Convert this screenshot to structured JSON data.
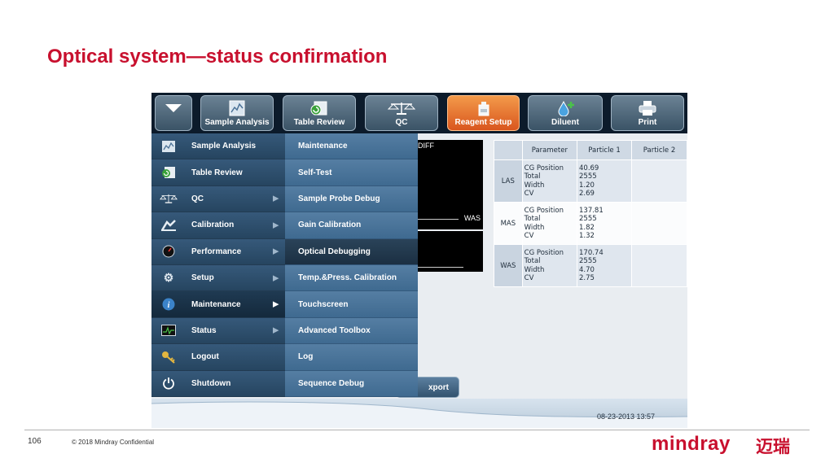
{
  "slide": {
    "title": "Optical system—status confirmation",
    "page_number": "106",
    "copyright": "© 2018 Mindray Confidential",
    "logo_text": "mindray",
    "logo_cn": "迈瑞",
    "brand_color": "#c8102e"
  },
  "toolbar": {
    "menu_icon": "triangle-down-icon",
    "buttons": [
      {
        "label": "Sample Analysis",
        "icon": "sample-analysis-icon"
      },
      {
        "label": "Table Review",
        "icon": "table-review-icon"
      },
      {
        "label": "QC",
        "icon": "scale-icon"
      },
      {
        "label": "Reagent Setup",
        "icon": "reagent-icon",
        "active": true
      },
      {
        "label": "Diluent",
        "icon": "diluent-icon"
      },
      {
        "label": "Print",
        "icon": "printer-icon"
      }
    ]
  },
  "main_menu": {
    "items": [
      {
        "label": "Sample Analysis",
        "icon": "sample-analysis-icon",
        "submenu": false
      },
      {
        "label": "Table Review",
        "icon": "table-review-icon",
        "submenu": false
      },
      {
        "label": "QC",
        "icon": "scale-icon",
        "submenu": true
      },
      {
        "label": "Calibration",
        "icon": "calibration-icon",
        "submenu": true
      },
      {
        "label": "Performance",
        "icon": "performance-icon",
        "submenu": true
      },
      {
        "label": "Setup",
        "icon": "gear-icon",
        "submenu": true
      },
      {
        "label": "Maintenance",
        "icon": "info-icon",
        "submenu": true,
        "selected": true
      },
      {
        "label": "Status",
        "icon": "status-icon",
        "submenu": true
      },
      {
        "label": "Logout",
        "icon": "key-icon",
        "submenu": false
      },
      {
        "label": "Shutdown",
        "icon": "power-icon",
        "submenu": false
      }
    ]
  },
  "submenu": {
    "items": [
      {
        "label": "Maintenance"
      },
      {
        "label": "Self-Test"
      },
      {
        "label": "Sample Probe Debug"
      },
      {
        "label": "Gain Calibration"
      },
      {
        "label": "Optical Debugging",
        "selected": true
      },
      {
        "label": "Temp.&Press. Calibration"
      },
      {
        "label": "Touchscreen"
      },
      {
        "label": "Advanced Toolbox"
      },
      {
        "label": "Log"
      },
      {
        "label": "Sequence Debug"
      }
    ]
  },
  "plots": {
    "diff_label": "DIFF",
    "was_label": "WAS"
  },
  "export_button": {
    "label": "xport"
  },
  "params_table": {
    "headers": [
      "Parameter",
      "Particle 1",
      "Particle 2"
    ],
    "rows": [
      {
        "label": "LAS",
        "params": [
          "CG Position",
          "Total",
          "Width",
          "CV"
        ],
        "p1": [
          "40.69",
          "2555",
          "1.20",
          "2.69"
        ],
        "p2": [
          "",
          "",
          "",
          ""
        ]
      },
      {
        "label": "MAS",
        "params": [
          "CG Position",
          "Total",
          "Width",
          "CV"
        ],
        "p1": [
          "137.81",
          "2555",
          "1.82",
          "1.32"
        ],
        "p2": [
          "",
          "",
          "",
          ""
        ]
      },
      {
        "label": "WAS",
        "params": [
          "CG Position",
          "Total",
          "Width",
          "CV"
        ],
        "p1": [
          "170.74",
          "2555",
          "4.70",
          "2.75"
        ],
        "p2": [
          "",
          "",
          "",
          ""
        ]
      }
    ]
  },
  "status_bar": {
    "datetime": "08-23-2013 13:57"
  }
}
